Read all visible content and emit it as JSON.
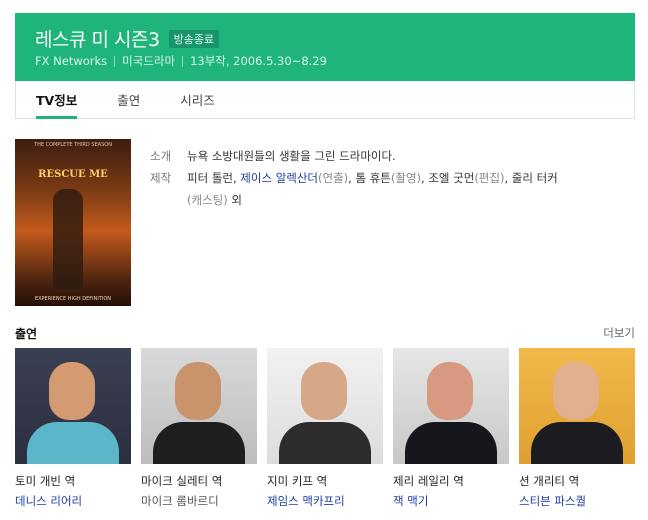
{
  "header": {
    "title": "레스큐 미 시즌3",
    "status_badge": "방송종료",
    "network": "FX Networks",
    "genre": "미국드라마",
    "episodes_dates": "13부작, 2006.5.30~8.29"
  },
  "tabs": [
    {
      "label": "TV정보",
      "active": true
    },
    {
      "label": "출연",
      "active": false
    },
    {
      "label": "시리즈",
      "active": false
    }
  ],
  "poster": {
    "top_text": "THE COMPLETE THIRD SEASON",
    "logo_text": "RESCUE ME",
    "bottom_text": "EXPERIENCE HIGH DEFINITION"
  },
  "info": {
    "intro_label": "소개",
    "intro_text": "뉴욕 소방대원들의 생활을 그린 드라마이다.",
    "credits_label": "제작",
    "credits": {
      "p1": "피터 톨런, ",
      "p2": "제이스 알렉산더",
      "p3": "(연출)",
      "p4": ", 톰 휴튼",
      "p5": "(촬영)",
      "p6": ", 조엘 굿먼",
      "p7": "(편집)",
      "p8": ", 줄리 터커",
      "p9": "(캐스팅)",
      "p10": " 외"
    }
  },
  "cast": {
    "heading": "출연",
    "more_label": "더보기",
    "members": [
      {
        "role": "토미 개빈 역",
        "name": "데니스 리어리",
        "linked": true
      },
      {
        "role": "마이크 실레티 역",
        "name": "마이크 롬바르디",
        "linked": false
      },
      {
        "role": "지미 키프 역",
        "name": "제임스 맥카프리",
        "linked": true
      },
      {
        "role": "제리 레일리 역",
        "name": "잭 맥기",
        "linked": true
      },
      {
        "role": "션 개리티 역",
        "name": "스티븐 파스퀄",
        "linked": true
      }
    ]
  },
  "colors": {
    "accent": "#1fb57a",
    "link": "#1d3ea7"
  }
}
